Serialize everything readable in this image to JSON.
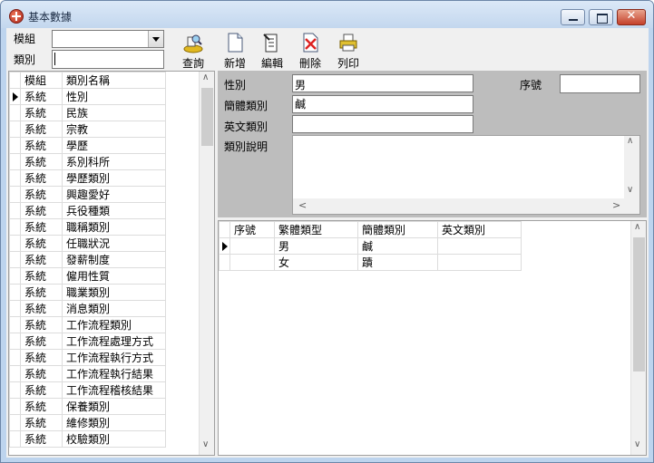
{
  "window": {
    "title": "基本數據"
  },
  "filters": {
    "module_label": "模組",
    "module_value": "",
    "category_label": "類別",
    "category_value": ""
  },
  "toolbar": {
    "query": "查詢",
    "add": "新增",
    "edit": "編輯",
    "delete": "刪除",
    "print": "列印"
  },
  "left_list": {
    "headers": [
      "模組",
      "類別名稱"
    ],
    "rows": [
      [
        "系統",
        "性別"
      ],
      [
        "系統",
        "民族"
      ],
      [
        "系統",
        "宗教"
      ],
      [
        "系統",
        "學歷"
      ],
      [
        "系統",
        "系別科所"
      ],
      [
        "系統",
        "學歷類別"
      ],
      [
        "系統",
        "興趣愛好"
      ],
      [
        "系統",
        "兵役種類"
      ],
      [
        "系統",
        "職稱類別"
      ],
      [
        "系統",
        "任職狀況"
      ],
      [
        "系統",
        "發薪制度"
      ],
      [
        "系統",
        "僱用性質"
      ],
      [
        "系統",
        "職業類別"
      ],
      [
        "系統",
        "消息類別"
      ],
      [
        "系統",
        "工作流程類別"
      ],
      [
        "系統",
        "工作流程處理方式"
      ],
      [
        "系統",
        "工作流程執行方式"
      ],
      [
        "系統",
        "工作流程執行結果"
      ],
      [
        "系統",
        "工作流程稽核結果"
      ],
      [
        "系統",
        "保養類別"
      ],
      [
        "系統",
        "維修類別"
      ],
      [
        "系統",
        "校驗類別"
      ]
    ]
  },
  "detail": {
    "category_label": "性別",
    "category_value": "男",
    "simplified_label": "簡體類別",
    "simplified_value": "鹹",
    "english_label": "英文類別",
    "english_value": "",
    "description_label": "類別說明",
    "description_value": "",
    "seq_label": "序號",
    "seq_value": ""
  },
  "right_grid": {
    "headers": [
      "序號",
      "繁體類型",
      "簡體類別",
      "英文類別"
    ],
    "rows": [
      [
        "",
        "男",
        "鹹",
        ""
      ],
      [
        "",
        "女",
        "蹟",
        ""
      ]
    ]
  }
}
